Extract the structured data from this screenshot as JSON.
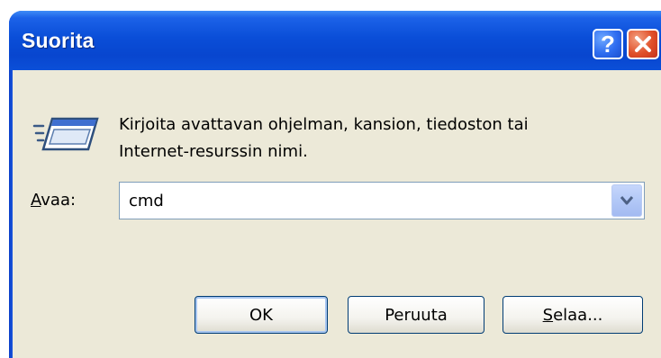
{
  "window": {
    "title": "Suorita",
    "help_glyph": "?"
  },
  "dialog": {
    "description_line1": "Kirjoita avattavan ohjelman, kansion, tiedoston tai",
    "description_line2": "Internet-resurssin nimi.",
    "open_label_accel": "A",
    "open_label_rest": "vaa:",
    "open_value": "cmd"
  },
  "buttons": {
    "ok_label": "OK",
    "cancel_label": "Peruuta",
    "browse_accel": "S",
    "browse_rest": "elaa..."
  },
  "icons": {
    "run": "run-icon",
    "help": "help-icon",
    "close": "close-icon",
    "dropdown": "chevron-down-icon"
  },
  "colors": {
    "titlebar": "#0a4ed8",
    "client_bg": "#ece9d8",
    "close_button": "#e0502a",
    "help_button": "#2e6cf0"
  }
}
